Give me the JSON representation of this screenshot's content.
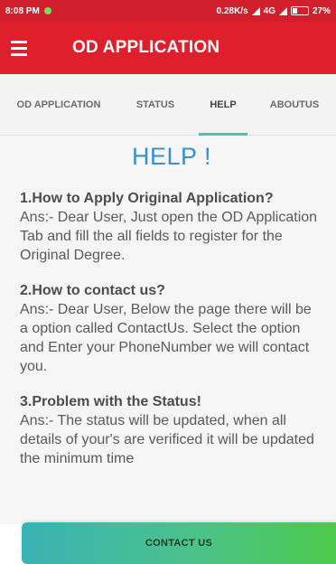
{
  "status_bar": {
    "time": "8:08 PM",
    "network": "0.28K/s",
    "signal_text": "4G",
    "battery": "27%"
  },
  "app_bar": {
    "title": "OD APPLICATION",
    "menu_icon": "menu-icon"
  },
  "tabs": [
    {
      "label": "OD APPLICATION",
      "active": false
    },
    {
      "label": "STATUS",
      "active": false
    },
    {
      "label": "HELP",
      "active": true
    },
    {
      "label": "ABOUTUS",
      "active": false
    }
  ],
  "help": {
    "title": "HELP !",
    "faqs": [
      {
        "question": "1.How to Apply Original Application?",
        "answer": "Ans:- Dear User, Just open the OD Application Tab and fill the all fields to register for the Original Degree."
      },
      {
        "question": "2.How to contact us?",
        "answer": "Ans:- Dear User, Below the page there will be a option called ContactUs. Select the option and Enter your PhoneNumber we will contact you."
      },
      {
        "question": "3.Problem with the Status!",
        "answer": "Ans:- The status will be updated, when all details of your's are verificed it will be updated the minimum time"
      }
    ]
  },
  "contact_button": {
    "label": "CONTACT US"
  },
  "colors": {
    "status_bar": "#d11f2c",
    "app_bar": "#e01f2c",
    "tab_indicator": "#4fb8c9",
    "help_title": "#3b8fd0",
    "button_start": "#38b3b5",
    "button_end": "#4dca4c"
  }
}
